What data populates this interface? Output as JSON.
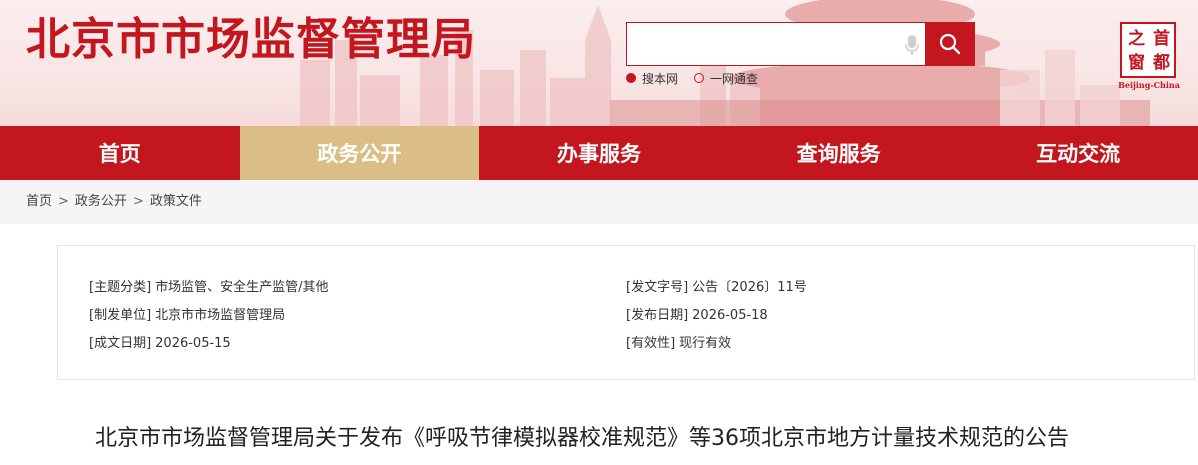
{
  "header": {
    "site_title": "北京市市场监督管理局",
    "search": {
      "placeholder": "",
      "options": [
        {
          "label": "搜本网",
          "selected": true
        },
        {
          "label": "一网通查",
          "selected": false
        }
      ]
    },
    "logo": {
      "chars": [
        "首",
        "都",
        "之",
        "窗"
      ],
      "caption": "Beijing-China"
    }
  },
  "nav": {
    "items": [
      {
        "label": "首页",
        "active": false
      },
      {
        "label": "政务公开",
        "active": true
      },
      {
        "label": "办事服务",
        "active": false
      },
      {
        "label": "查询服务",
        "active": false
      },
      {
        "label": "互动交流",
        "active": false
      }
    ]
  },
  "breadcrumb": {
    "items": [
      "首页",
      "政务公开",
      "政策文件"
    ],
    "separator": ">"
  },
  "info": {
    "topic": {
      "label": "[主题分类]",
      "value": "市场监管、安全生产监管/其他"
    },
    "doc_no": {
      "label": "[发文字号]",
      "value": "公告〔2026〕11号"
    },
    "issuer": {
      "label": "[制发单位]",
      "value": "北京市市场监督管理局"
    },
    "pub_date": {
      "label": "[发布日期]",
      "value": "2026-05-18"
    },
    "made_date": {
      "label": "[成文日期]",
      "value": "2026-05-15"
    },
    "validity": {
      "label": "[有效性]",
      "value": "现行有效"
    }
  },
  "article": {
    "title": "北京市市场监督管理局关于发布《呼吸节律模拟器校准规范》等36项北京市地方计量技术规范的公告"
  },
  "colors": {
    "brand_red": "#c3161f",
    "nav_active": "#dbbd86",
    "crumb_bg": "#f5f5f5"
  }
}
